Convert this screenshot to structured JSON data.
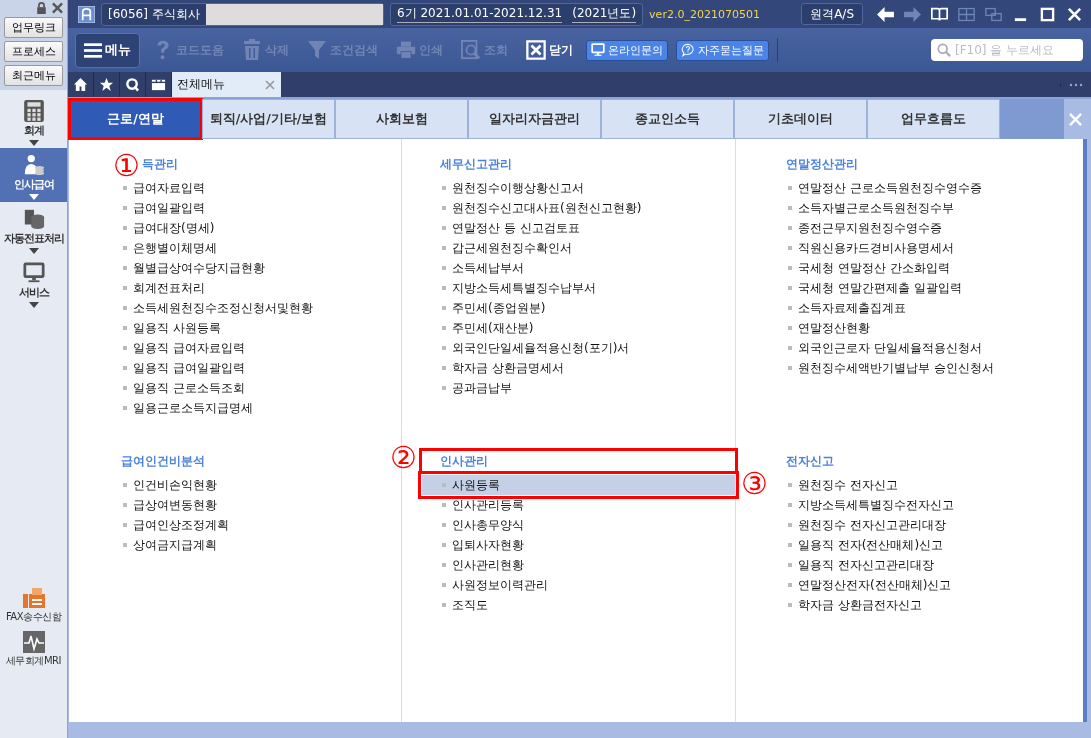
{
  "title_bar": {
    "company": "[6056] 주식회사",
    "period": "6기  2021.01.01-2021.12.31",
    "fiscal_year": "(2021년도)",
    "version": "ver2.0_2021070501",
    "remote_button": "원격A/S"
  },
  "sidebar": {
    "quick_buttons": [
      "업무링크",
      "프로세스",
      "최근메뉴"
    ],
    "modules": [
      {
        "label": "회계",
        "selected": false
      },
      {
        "label": "인사급여",
        "selected": true
      },
      {
        "label": "자동전표처리",
        "selected": false
      },
      {
        "label": "서비스",
        "selected": false
      }
    ],
    "bottom_items": [
      {
        "label": "FAX송수신함"
      },
      {
        "label": "세무회계MRI"
      }
    ]
  },
  "toolbar": {
    "menu_button": "메뉴",
    "buttons": [
      {
        "label": "코드도움",
        "disabled": true
      },
      {
        "label": "삭제",
        "disabled": true
      },
      {
        "label": "조건검색",
        "disabled": true
      },
      {
        "label": "인쇄",
        "disabled": true
      },
      {
        "label": "조회",
        "disabled": true
      },
      {
        "label": "닫기",
        "disabled": false
      }
    ],
    "links": [
      {
        "label": "온라인문의"
      },
      {
        "label": "자주묻는질문"
      }
    ],
    "search": {
      "placeholder": "[F10] 을 누르세요"
    }
  },
  "doc_tabs": [
    {
      "label": "전체메뉴",
      "selected": true
    }
  ],
  "category_tabs": [
    {
      "label": "근로/연말",
      "selected": true,
      "annotation": "①"
    },
    {
      "label": "퇴직/사업/기타/보험",
      "selected": false
    },
    {
      "label": "사회보험",
      "selected": false
    },
    {
      "label": "일자리자금관리",
      "selected": false
    },
    {
      "label": "종교인소득",
      "selected": false
    },
    {
      "label": "기초데이터",
      "selected": false
    },
    {
      "label": "업무흐름도",
      "selected": false
    }
  ],
  "sections": [
    {
      "title": "득관리",
      "items": [
        {
          "label": "급여자료입력",
          "selected": false
        },
        {
          "label": "급여일괄입력",
          "selected": false
        },
        {
          "label": "급여대장(명세)",
          "selected": false
        },
        {
          "label": "은행별이체명세",
          "selected": false
        },
        {
          "label": "월별급상여수당지급현황",
          "selected": false
        },
        {
          "label": "회계전표처리",
          "selected": false
        },
        {
          "label": "소득세원천징수조정신청서및현황",
          "selected": false
        },
        {
          "label": "일용직 사원등록",
          "selected": false
        },
        {
          "label": "일용직 급여자료입력",
          "selected": false
        },
        {
          "label": "일용직 급여일괄입력",
          "selected": false
        },
        {
          "label": "일용직 근로소득조회",
          "selected": false
        },
        {
          "label": "일용근로소득지급명세",
          "selected": false
        }
      ]
    },
    {
      "title": "세무신고관리",
      "items": [
        {
          "label": "원천징수이행상황신고서",
          "selected": false
        },
        {
          "label": "원천징수신고대사표(원천신고현황)",
          "selected": false
        },
        {
          "label": "연말정산 등 신고검토표",
          "selected": false
        },
        {
          "label": "갑근세원천징수확인서",
          "selected": false
        },
        {
          "label": "소득세납부서",
          "selected": false
        },
        {
          "label": "지방소득세특별징수납부서",
          "selected": false
        },
        {
          "label": "주민세(종업원분)",
          "selected": false
        },
        {
          "label": "주민세(재산분)",
          "selected": false
        },
        {
          "label": "외국인단일세율적용신청(포기)서",
          "selected": false
        },
        {
          "label": "학자금 상환금명세서",
          "selected": false
        },
        {
          "label": "공과금납부",
          "selected": false
        }
      ]
    },
    {
      "title": "연말정산관리",
      "items": [
        {
          "label": "연말정산 근로소득원천징수영수증",
          "selected": false
        },
        {
          "label": "소득자별근로소득원천징수부",
          "selected": false
        },
        {
          "label": "종전근무지원천징수영수증",
          "selected": false
        },
        {
          "label": "직원신용카드경비사용명세서",
          "selected": false
        },
        {
          "label": "국세청 연말정산 간소화입력",
          "selected": false
        },
        {
          "label": "국세청 연말간편제출 일괄입력",
          "selected": false
        },
        {
          "label": "소득자료제출집계표",
          "selected": false
        },
        {
          "label": "연말정산현황",
          "selected": false
        },
        {
          "label": "외국인근로자 단일세율적용신청서",
          "selected": false
        },
        {
          "label": "원천징수세액반기별납부 승인신청서",
          "selected": false
        }
      ]
    },
    {
      "title": "급여인건비분석",
      "items": [
        {
          "label": "인건비손익현황",
          "selected": false
        },
        {
          "label": "급상여변동현황",
          "selected": false
        },
        {
          "label": "급여인상조정계획",
          "selected": false
        },
        {
          "label": "상여금지급계획",
          "selected": false
        }
      ]
    },
    {
      "title": "인사관리",
      "annotation": "②",
      "items": [
        {
          "label": "사원등록",
          "selected": true,
          "annotation": "③"
        },
        {
          "label": "인사관리등록",
          "selected": false
        },
        {
          "label": "인사총무양식",
          "selected": false
        },
        {
          "label": "입퇴사자현황",
          "selected": false
        },
        {
          "label": "인사관리현황",
          "selected": false
        },
        {
          "label": "사원정보이력관리",
          "selected": false
        },
        {
          "label": "조직도",
          "selected": false
        }
      ]
    },
    {
      "title": "전자신고",
      "items": [
        {
          "label": "원천징수 전자신고",
          "selected": false
        },
        {
          "label": "지방소득세특별징수전자신고",
          "selected": false
        },
        {
          "label": "원천징수 전자신고관리대장",
          "selected": false
        },
        {
          "label": "일용직 전자(전산매체)신고",
          "selected": false
        },
        {
          "label": "일용직 전자신고관리대장",
          "selected": false
        },
        {
          "label": "연말정산전자(전산매체)신고",
          "selected": false
        },
        {
          "label": "학자금 상환금전자신고",
          "selected": false
        }
      ]
    }
  ]
}
